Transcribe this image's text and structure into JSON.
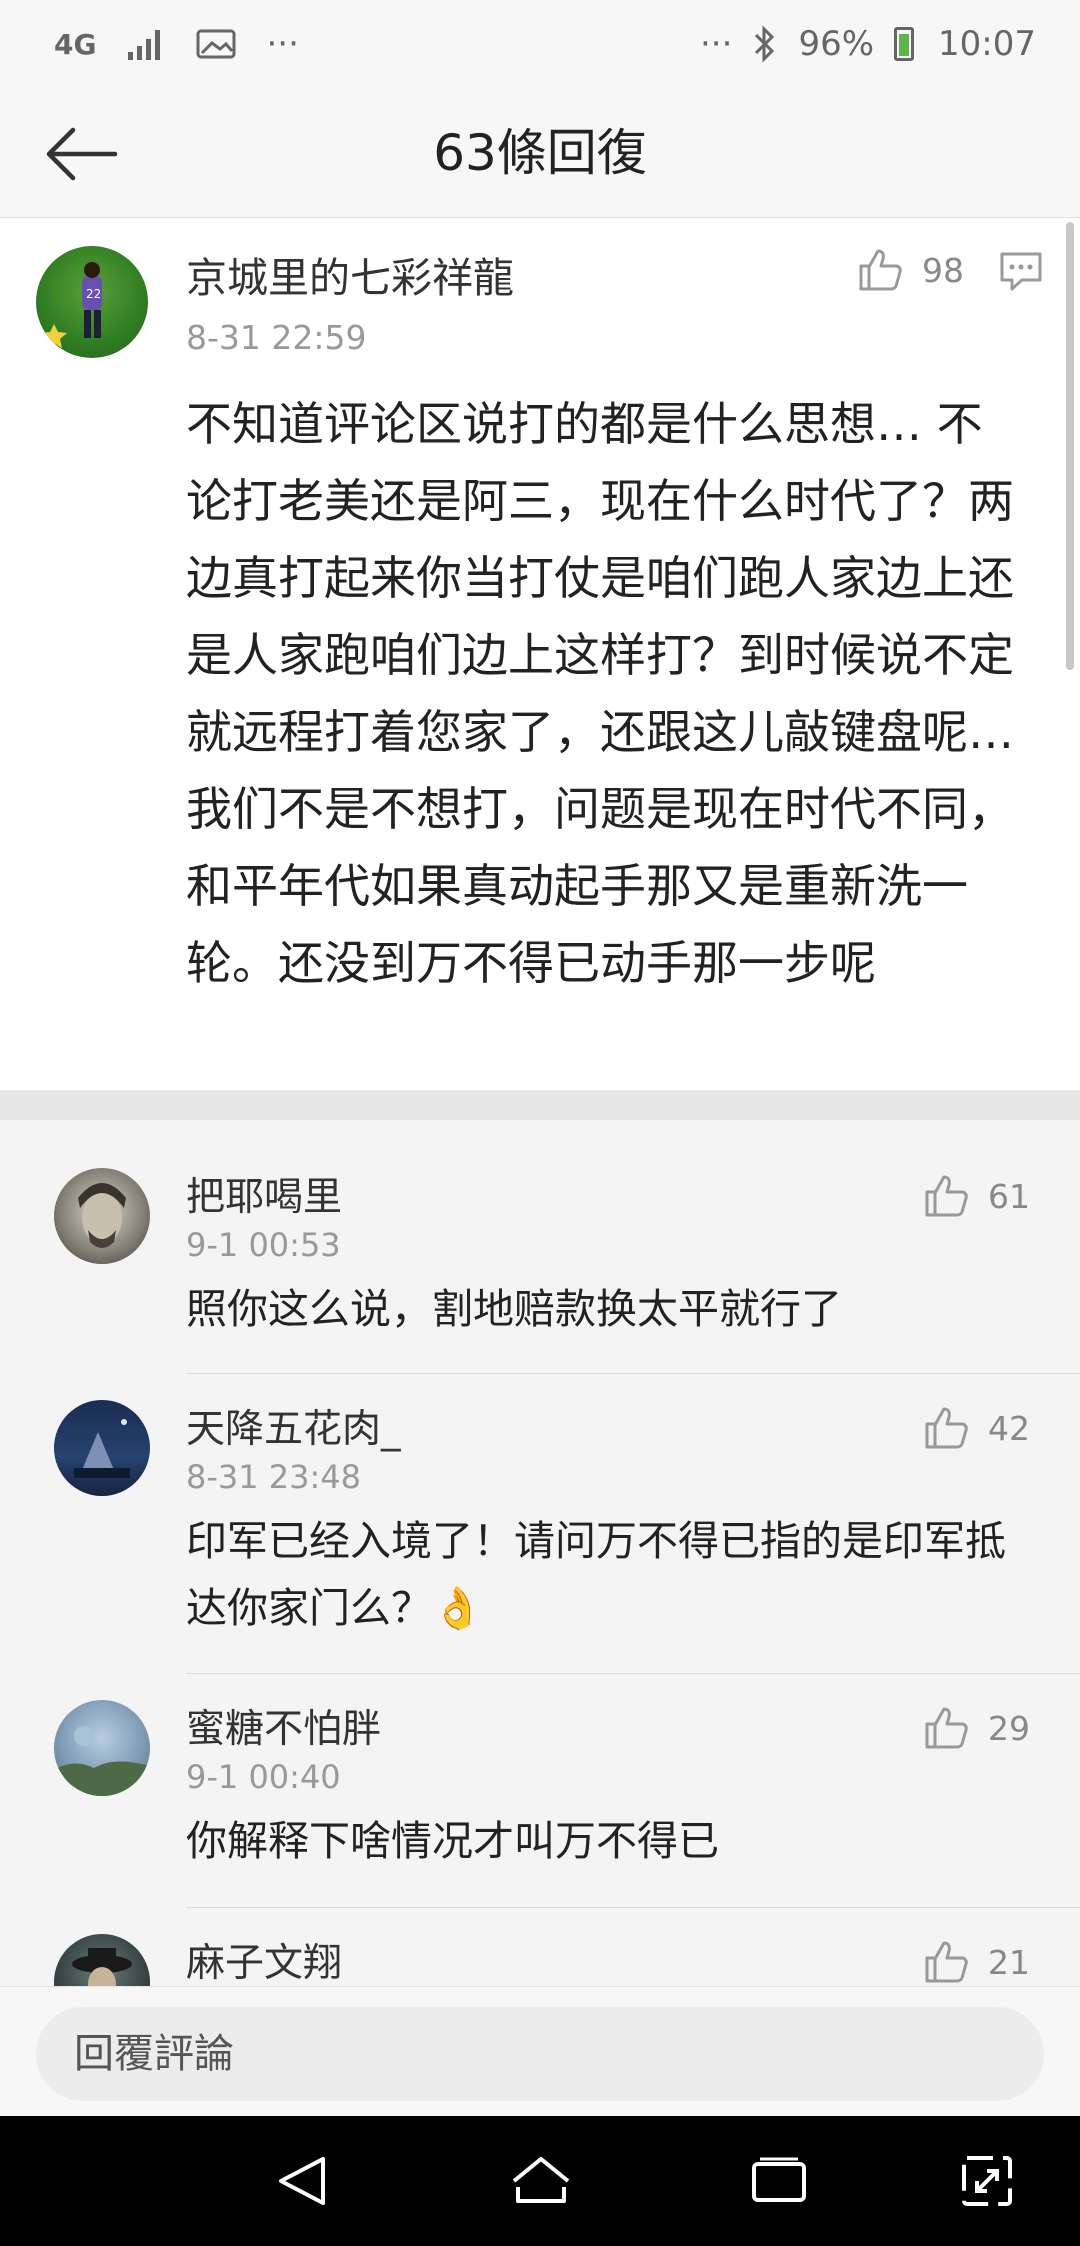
{
  "status_bar": {
    "network": "4G",
    "more_left": "···",
    "more_right": "···",
    "battery": "96%",
    "time": "10:07",
    "icons": [
      "signal-icon",
      "image-icon",
      "bluetooth-icon",
      "battery-icon"
    ]
  },
  "header": {
    "title": "63條回復",
    "back_icon": "arrow-left-icon"
  },
  "main_comment": {
    "username": "京城里的七彩祥龍",
    "timestamp": "8-31 22:59",
    "likes": "98",
    "text": "不知道评论区说打的都是什么思想… 不论打老美还是阿三，现在什么时代了？两边真打起来你当打仗是咱们跑人家边上还是人家跑咱们边上这样打？到时候说不定就远程打着您家了，还跟这儿敲键盘呢… 我们不是不想打，问题是现在时代不同，和平年代如果真动起手那又是重新洗一轮。还没到万不得已动手那一步呢"
  },
  "replies": [
    {
      "username": "把耶喝里",
      "timestamp": "9-1 00:53",
      "likes": "61",
      "text": "照你这么说，割地赔款换太平就行了"
    },
    {
      "username": "天降五花肉_",
      "timestamp": "8-31 23:48",
      "likes": "42",
      "text": "印军已经入境了！请问万不得已指的是印军抵达你家门么？👌"
    },
    {
      "username": "蜜糖不怕胖",
      "timestamp": "9-1 00:40",
      "likes": "29",
      "text": "你解释下啥情况才叫万不得已"
    },
    {
      "username": "麻子文翔",
      "timestamp": "",
      "likes": "21",
      "text": ""
    }
  ],
  "input": {
    "placeholder": "回覆評論"
  },
  "colors": {
    "background": "#f4f4f4",
    "card": "#ffffff",
    "text": "#222222",
    "muted": "#999999",
    "navbar": "#000000"
  }
}
